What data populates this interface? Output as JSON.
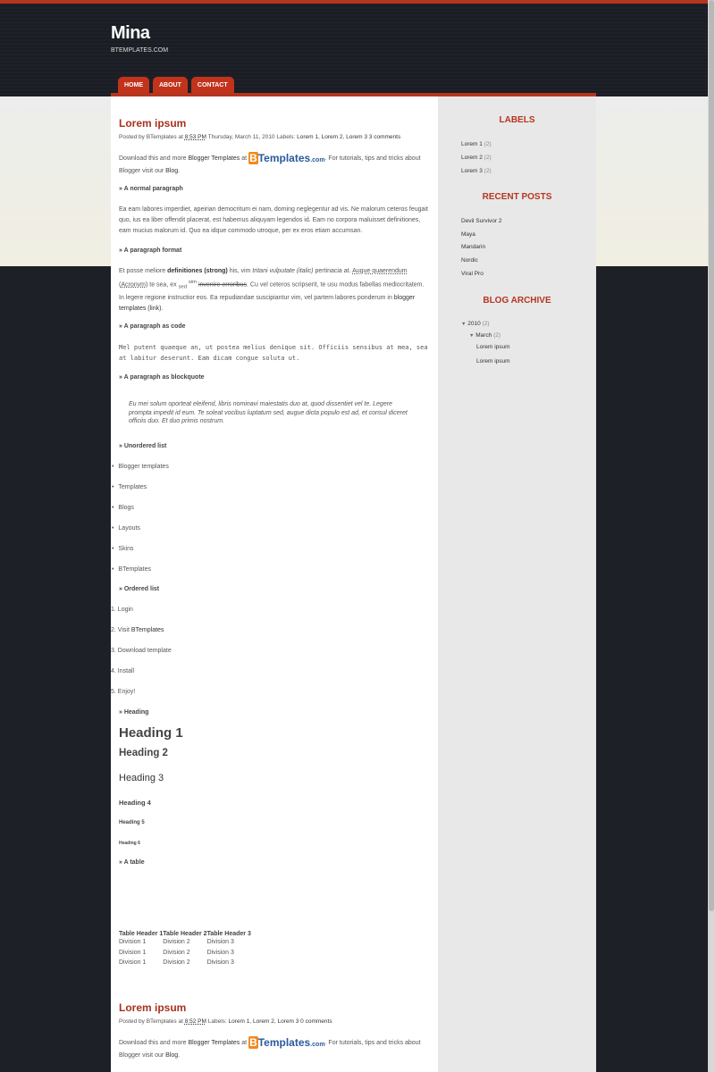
{
  "blog": {
    "title": "Mina",
    "description": "BTEMPLATES.COM"
  },
  "nav": [
    {
      "label": "HOME"
    },
    {
      "label": "ABOUT"
    },
    {
      "label": "CONTACT"
    }
  ],
  "posts": [
    {
      "title": "Lorem ipsum",
      "posted_by": "Posted by BTemplates at",
      "time": "8:53 PM",
      "date": "Thursday, March 11, 2010",
      "labels_prefix": "Labels:",
      "labels": [
        "Lorem 1",
        "Lorem 2",
        "Lorem 3"
      ],
      "comments": "3 comments",
      "intro": {
        "pre": "Download this and more",
        "link1": "Blogger Templates",
        "at": "at",
        "logo": "BTemplates.com",
        "post": ". For tutorials, tips and tricks about Blogger visit our",
        "link2": "Blog",
        "end": "."
      },
      "sections": {
        "normal_h": "» A normal paragraph",
        "normal": "Ea eam labores imperdiet, apeirian democritum ei nam, doming neglegentur ad vis. Ne malorum ceteros feugait quo, ius ea liber offendit placerat, est habemus aliquyam legendos id. Eam no corpora maluisset definitiones, eam mucius malorum id. Quo ea idque commodo utroque, per ex eros etiam accumsan.",
        "format_h": "» A paragraph format",
        "format": {
          "a": "Et posse meliore",
          "strong": "definitiones (strong)",
          "b": "his, vim",
          "italic": "tritani vulputate (italic)",
          "c": "pertinacia at.",
          "acronym1": "Augue quaerendum",
          "acronym2": "Acronym",
          "d": "te sea, ex",
          "sub": "sed",
          "sup": "sim",
          "strike": "invenire erroribus",
          "e": ". Cu vel ceteros scripserit, te usu modus fabellas mediocritatem. In legere regione instructior eos. Ea repudiandae suscipiantur vim, vel partem labores ponderum in",
          "link": "blogger templates (link)",
          "f": "."
        },
        "code_h": "» A paragraph as code",
        "code": "Mel putent quaeque an, ut postea melius denique sit. Officiis sensibus at mea, sea at labitur deserunt. Eam dicam congue soluta ut.",
        "quote_h": "» A paragraph as blockquote",
        "quote": "Eu mei solum oporteat eleifend, libris nominavi maiestatis duo at, quod dissentiet vel te. Legere prompta impedit id eum. Te soleat vocibus luptatum sed, augue dicta populo est ad, et consul diceret officiis duo. Et duo primis nostrum.",
        "ul_h": "» Unordered list",
        "ul": [
          "Blogger templates",
          "Templates",
          "Blogs",
          "Layouts",
          "Skins",
          "BTemplates"
        ],
        "ol_h": "» Ordered list",
        "ol": [
          "Login",
          "Visit",
          "Download template",
          "Install",
          "Enjoy!"
        ],
        "ol_link": "BTemplates",
        "headings_h": "» Heading",
        "headings": [
          "Heading 1",
          "Heading 2",
          "Heading 3",
          "Heading 4",
          "Heading 5",
          "Heading 6"
        ],
        "table_h": "» A table",
        "table": {
          "headers": [
            "Table Header 1",
            "Table Header 2",
            "Table Header 3"
          ],
          "rows": [
            [
              "Division 1",
              "Division 2",
              "Division 3"
            ],
            [
              "Division 1",
              "Division 2",
              "Division 3"
            ],
            [
              "Division 1",
              "Division 2",
              "Division 3"
            ]
          ]
        }
      }
    },
    {
      "title": "Lorem ipsum",
      "posted_by": "Posted by BTemplates at",
      "time": "8:52 PM",
      "labels_prefix": "Labels:",
      "labels": [
        "Lorem 1",
        "Lorem 2",
        "Lorem 3"
      ],
      "comments": "0 comments"
    }
  ],
  "sidebar": {
    "labels": {
      "title": "LABELS",
      "items": [
        {
          "name": "Lorem 1",
          "count": "(2)"
        },
        {
          "name": "Lorem 2",
          "count": "(2)"
        },
        {
          "name": "Lorem 3",
          "count": "(2)"
        }
      ]
    },
    "recent": {
      "title": "RECENT POSTS",
      "items": [
        "Devil Survivor 2",
        "Maya",
        "Mandarin",
        "Nordic",
        "Viral Pro"
      ]
    },
    "archive": {
      "title": "BLOG ARCHIVE",
      "year": "2010",
      "year_count": "(2)",
      "month": "March",
      "month_count": "(2)",
      "posts": [
        "Lorem ipsum",
        "Lorem ipsum"
      ],
      "toggle": "▼"
    }
  },
  "colors": {
    "accent": "#b5361f",
    "title": "#a8321e",
    "header_bg": "#1e2128",
    "sidebar_bg": "#e8e8e8"
  }
}
